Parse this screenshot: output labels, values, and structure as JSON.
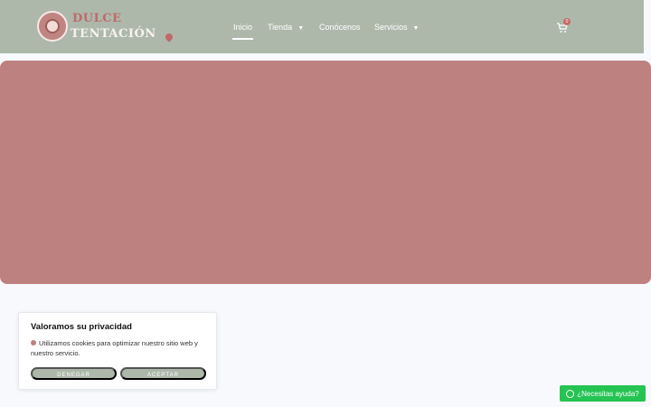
{
  "brand": {
    "line1": "DULCE",
    "line2": "TENTACIÓN",
    "primary_color": "#adb8ab",
    "accent_color": "#bd8180"
  },
  "nav": {
    "items": [
      {
        "label": "Inicio",
        "active": true
      },
      {
        "label": "Tienda",
        "dropdown": true
      },
      {
        "label": "Conócenos"
      },
      {
        "label": "Servicios",
        "dropdown": true
      }
    ]
  },
  "cart": {
    "count": "0",
    "icon": "cart-icon"
  },
  "cookie": {
    "title": "Valoramos su privacidad",
    "text": "Utilizamos cookies para optimizar nuestro sitio web y nuestro servicio.",
    "deny": "DENEGAR",
    "accept": "ACEPTAR"
  },
  "help": {
    "label": "¿Necesitas ayuda?",
    "icon": "whatsapp-icon"
  }
}
